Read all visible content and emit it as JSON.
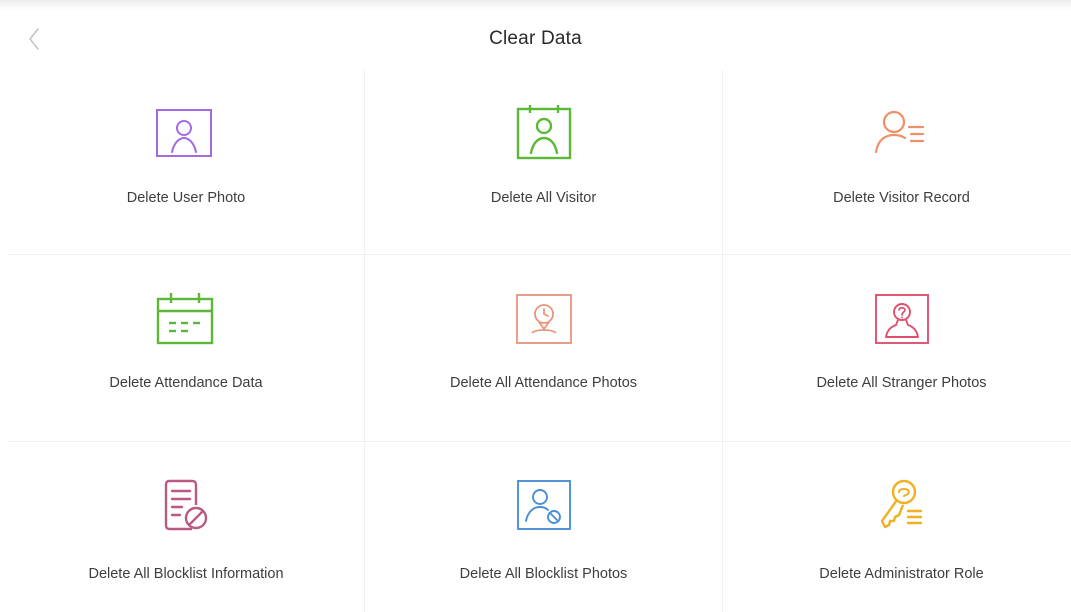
{
  "header": {
    "title": "Clear Data",
    "back_icon": "chevron-left-icon"
  },
  "tiles": [
    {
      "label": "Delete User Photo",
      "icon": "user-photo-icon",
      "color": "#a46ae0"
    },
    {
      "label": "Delete All Visitor",
      "icon": "visitor-badge-icon",
      "color": "#5cb838"
    },
    {
      "label": "Delete Visitor Record",
      "icon": "visitor-record-icon",
      "color": "#f0906a"
    },
    {
      "label": "Delete Attendance Data",
      "icon": "calendar-icon",
      "color": "#5cb838"
    },
    {
      "label": "Delete All Attendance Photos",
      "icon": "attendance-photo-icon",
      "color": "#e8957a"
    },
    {
      "label": "Delete All Stranger Photos",
      "icon": "stranger-photo-icon",
      "color": "#e0506e"
    },
    {
      "label": "Delete All Blocklist Information",
      "icon": "blocklist-document-icon",
      "color": "#b95a84"
    },
    {
      "label": "Delete All Blocklist Photos",
      "icon": "blocklist-photo-icon",
      "color": "#4a8fd6"
    },
    {
      "label": "Delete Administrator Role",
      "icon": "admin-key-icon",
      "color": "#f0b020"
    }
  ]
}
